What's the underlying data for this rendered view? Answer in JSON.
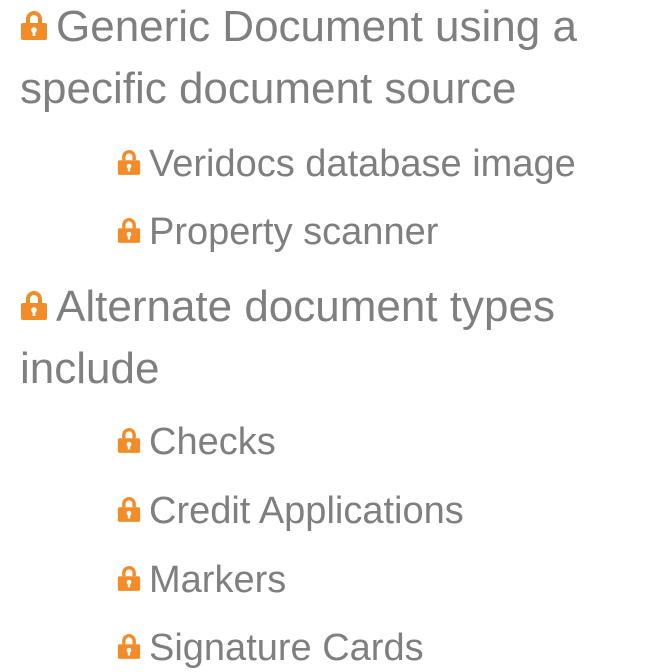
{
  "accent_color": "#f28c28",
  "text_color": "#7f7f7f",
  "bullet_icon": "padlock-icon",
  "sections": [
    {
      "label": "Generic Document using a specific document source",
      "items": [
        {
          "label": "Veridocs database image"
        },
        {
          "label": "Property scanner"
        }
      ]
    },
    {
      "label": "Alternate document types include",
      "items": [
        {
          "label": "Checks"
        },
        {
          "label": "Credit Applications"
        },
        {
          "label": "Markers"
        },
        {
          "label": "Signature Cards"
        }
      ]
    }
  ]
}
